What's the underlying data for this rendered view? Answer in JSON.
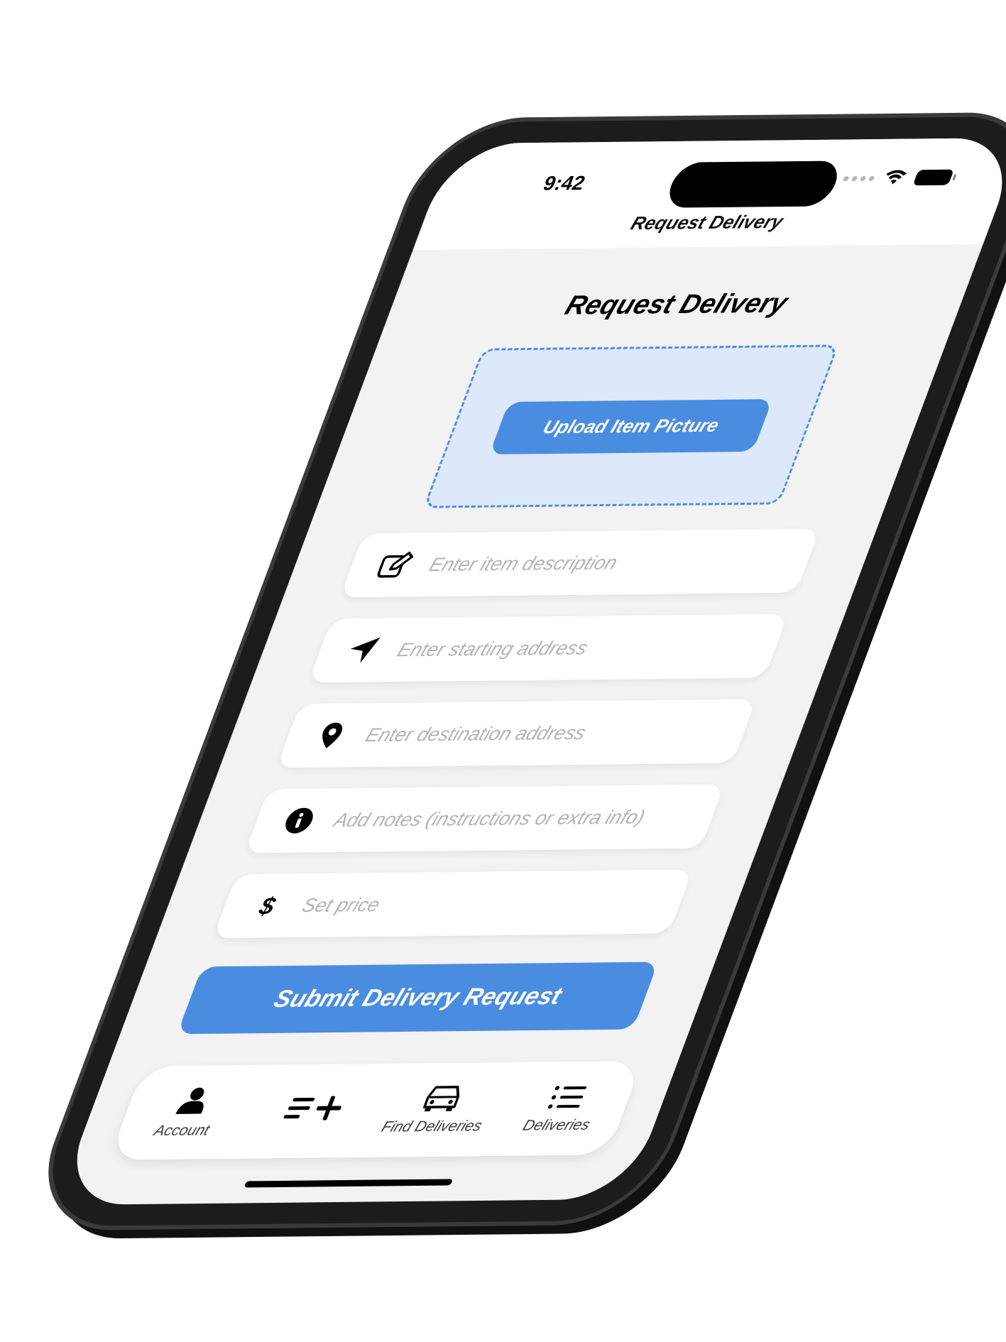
{
  "status_bar": {
    "time": "9:42"
  },
  "nav": {
    "title": "Request Delivery"
  },
  "page": {
    "title": "Request Delivery"
  },
  "upload": {
    "button_label": "Upload Item Picture"
  },
  "fields": {
    "description": {
      "placeholder": "Enter item description",
      "icon": "pencil-square-icon"
    },
    "start": {
      "placeholder": "Enter starting address",
      "icon": "location-arrow-icon"
    },
    "destination": {
      "placeholder": "Enter destination address",
      "icon": "map-pin-icon"
    },
    "notes": {
      "placeholder": "Add notes (instructions or extra info)",
      "icon": "info-circle-icon"
    },
    "price": {
      "placeholder": "Set price",
      "icon": "dollar-icon"
    }
  },
  "submit": {
    "label": "Submit Delivery Request"
  },
  "tabs": [
    {
      "label": "Account",
      "icon": "person-icon"
    },
    {
      "label": "",
      "icon": "list-add-icon"
    },
    {
      "label": "Find Deliveries",
      "icon": "car-icon"
    },
    {
      "label": "Deliveries",
      "icon": "list-icon"
    }
  ],
  "colors": {
    "accent": "#4a8de0",
    "upload_zone_bg": "#dde8fb",
    "screen_bg": "#f2f2f2"
  }
}
